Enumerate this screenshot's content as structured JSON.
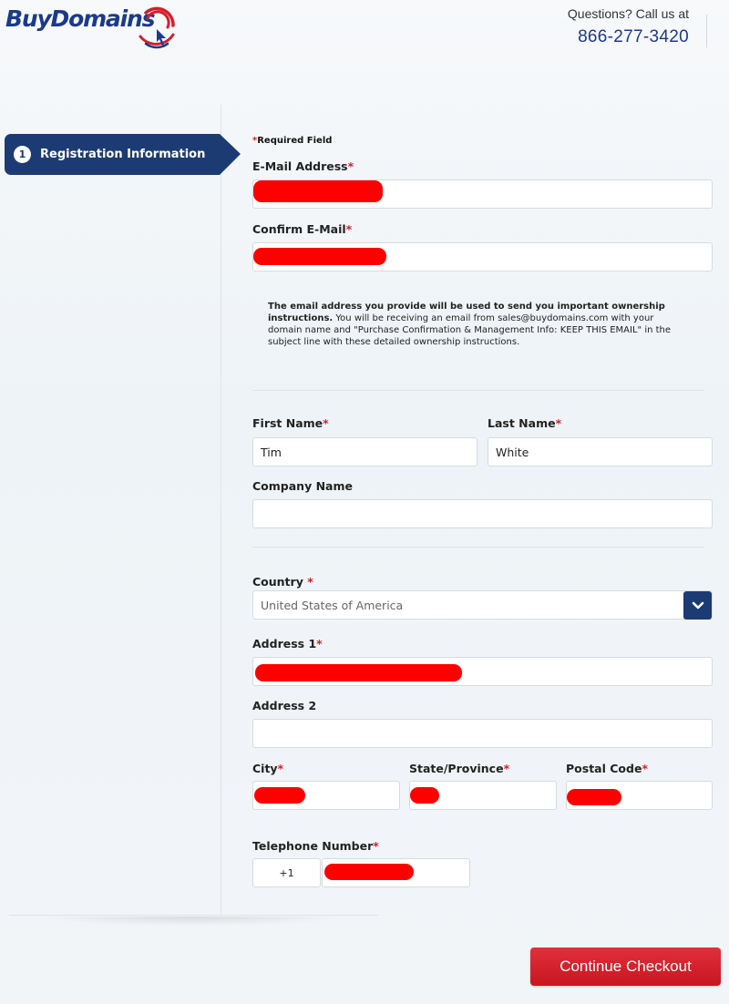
{
  "header": {
    "logo_text": "BuyDomains",
    "contact_question": "Questions? Call us at",
    "contact_phone": "866-277-3420"
  },
  "sidebar": {
    "steps": [
      {
        "number": "1",
        "label": "Registration Information",
        "active": true
      }
    ]
  },
  "form": {
    "required_note": "Required Field",
    "required_marker": "*",
    "email": {
      "label": "E-Mail Address",
      "value": ""
    },
    "confirm_email": {
      "label": "Confirm E-Mail",
      "value": ""
    },
    "info": {
      "bold": "The email address you provide will be used to send you important ownership instructions.",
      "text": " You will be receiving an email from sales@buydomains.com with your domain name and \"Purchase Confirmation & Management Info: KEEP THIS EMAIL\" in the subject line with these detailed ownership instructions."
    },
    "first_name": {
      "label": "First Name",
      "value": "Tim"
    },
    "last_name": {
      "label": "Last Name",
      "value": "White"
    },
    "company": {
      "label": "Company Name",
      "value": ""
    },
    "country": {
      "label": "Country",
      "value": "United States of America"
    },
    "address1": {
      "label": "Address 1",
      "value": ""
    },
    "address2": {
      "label": "Address 2",
      "value": ""
    },
    "city": {
      "label": "City",
      "value": ""
    },
    "state": {
      "label": "State/Province",
      "value": ""
    },
    "postal": {
      "label": "Postal Code",
      "value": ""
    },
    "telephone": {
      "label": "Telephone Number",
      "country_code": "+1",
      "value": ""
    }
  },
  "actions": {
    "continue_label": "Continue Checkout"
  },
  "colors": {
    "brand_navy": "#1d3b73",
    "accent_red": "#d41f2c",
    "redaction": "#ff0000"
  }
}
